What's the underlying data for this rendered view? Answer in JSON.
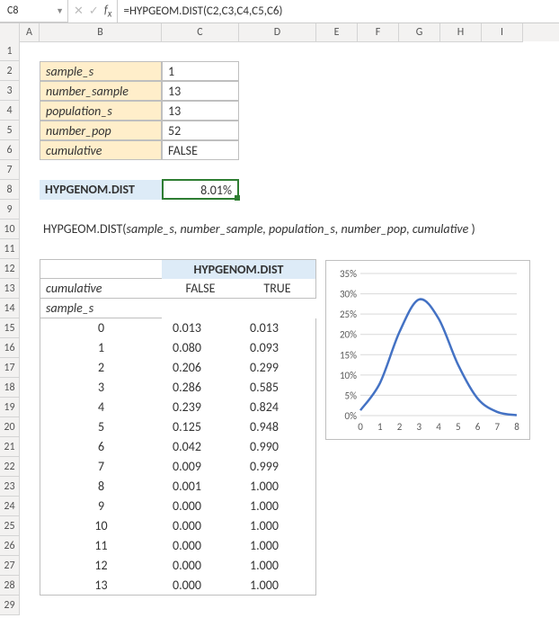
{
  "formula_bar": {
    "cell_ref": "C8",
    "formula": "=HYPGEOM.DIST(C2,C3,C4,C5,C6)"
  },
  "columns": [
    "",
    "A",
    "B",
    "C",
    "D",
    "E",
    "F",
    "G",
    "H",
    "I"
  ],
  "rows": [
    "1",
    "2",
    "3",
    "4",
    "5",
    "6",
    "7",
    "8",
    "9",
    "10",
    "11",
    "12",
    "13",
    "14",
    "15",
    "16",
    "17",
    "18",
    "19",
    "20",
    "21",
    "22",
    "23",
    "24",
    "25",
    "26",
    "27",
    "28",
    "29"
  ],
  "params": [
    {
      "label": "sample_s",
      "value": "1"
    },
    {
      "label": "number_sample",
      "value": "13"
    },
    {
      "label": "population_s",
      "value": "13"
    },
    {
      "label": "number_pop",
      "value": "52"
    },
    {
      "label": "cumulative",
      "value": "FALSE"
    }
  ],
  "result": {
    "label": "HYPGENOM.DIST",
    "value": "8.01%"
  },
  "syntax": {
    "fn": "HYPGEOM.DIST(",
    "args": "sample_s, number_sample, population_s, number_pop, cumulative",
    "close": " )"
  },
  "table": {
    "title": "HYPGENOM.DIST",
    "row_label_cum": "cumulative",
    "row_label_s": "sample_s",
    "col_false": "FALSE",
    "col_true": "TRUE",
    "rows": [
      {
        "s": "0",
        "f": "0.013",
        "t": "0.013"
      },
      {
        "s": "1",
        "f": "0.080",
        "t": "0.093"
      },
      {
        "s": "2",
        "f": "0.206",
        "t": "0.299"
      },
      {
        "s": "3",
        "f": "0.286",
        "t": "0.585"
      },
      {
        "s": "4",
        "f": "0.239",
        "t": "0.824"
      },
      {
        "s": "5",
        "f": "0.125",
        "t": "0.948"
      },
      {
        "s": "6",
        "f": "0.042",
        "t": "0.990"
      },
      {
        "s": "7",
        "f": "0.009",
        "t": "0.999"
      },
      {
        "s": "8",
        "f": "0.001",
        "t": "1.000"
      },
      {
        "s": "9",
        "f": "0.000",
        "t": "1.000"
      },
      {
        "s": "10",
        "f": "0.000",
        "t": "1.000"
      },
      {
        "s": "11",
        "f": "0.000",
        "t": "1.000"
      },
      {
        "s": "12",
        "f": "0.000",
        "t": "1.000"
      },
      {
        "s": "13",
        "f": "0.000",
        "t": "1.000"
      }
    ]
  },
  "chart_data": {
    "type": "line",
    "x": [
      0,
      1,
      2,
      3,
      4,
      5,
      6,
      7,
      8
    ],
    "values": [
      0.013,
      0.08,
      0.206,
      0.286,
      0.239,
      0.125,
      0.042,
      0.009,
      0.001
    ],
    "ylabels": [
      "0%",
      "5%",
      "10%",
      "15%",
      "20%",
      "25%",
      "30%",
      "35%"
    ],
    "ylim": [
      0,
      0.35
    ],
    "xlabel": "",
    "ylabel": "",
    "title": ""
  }
}
